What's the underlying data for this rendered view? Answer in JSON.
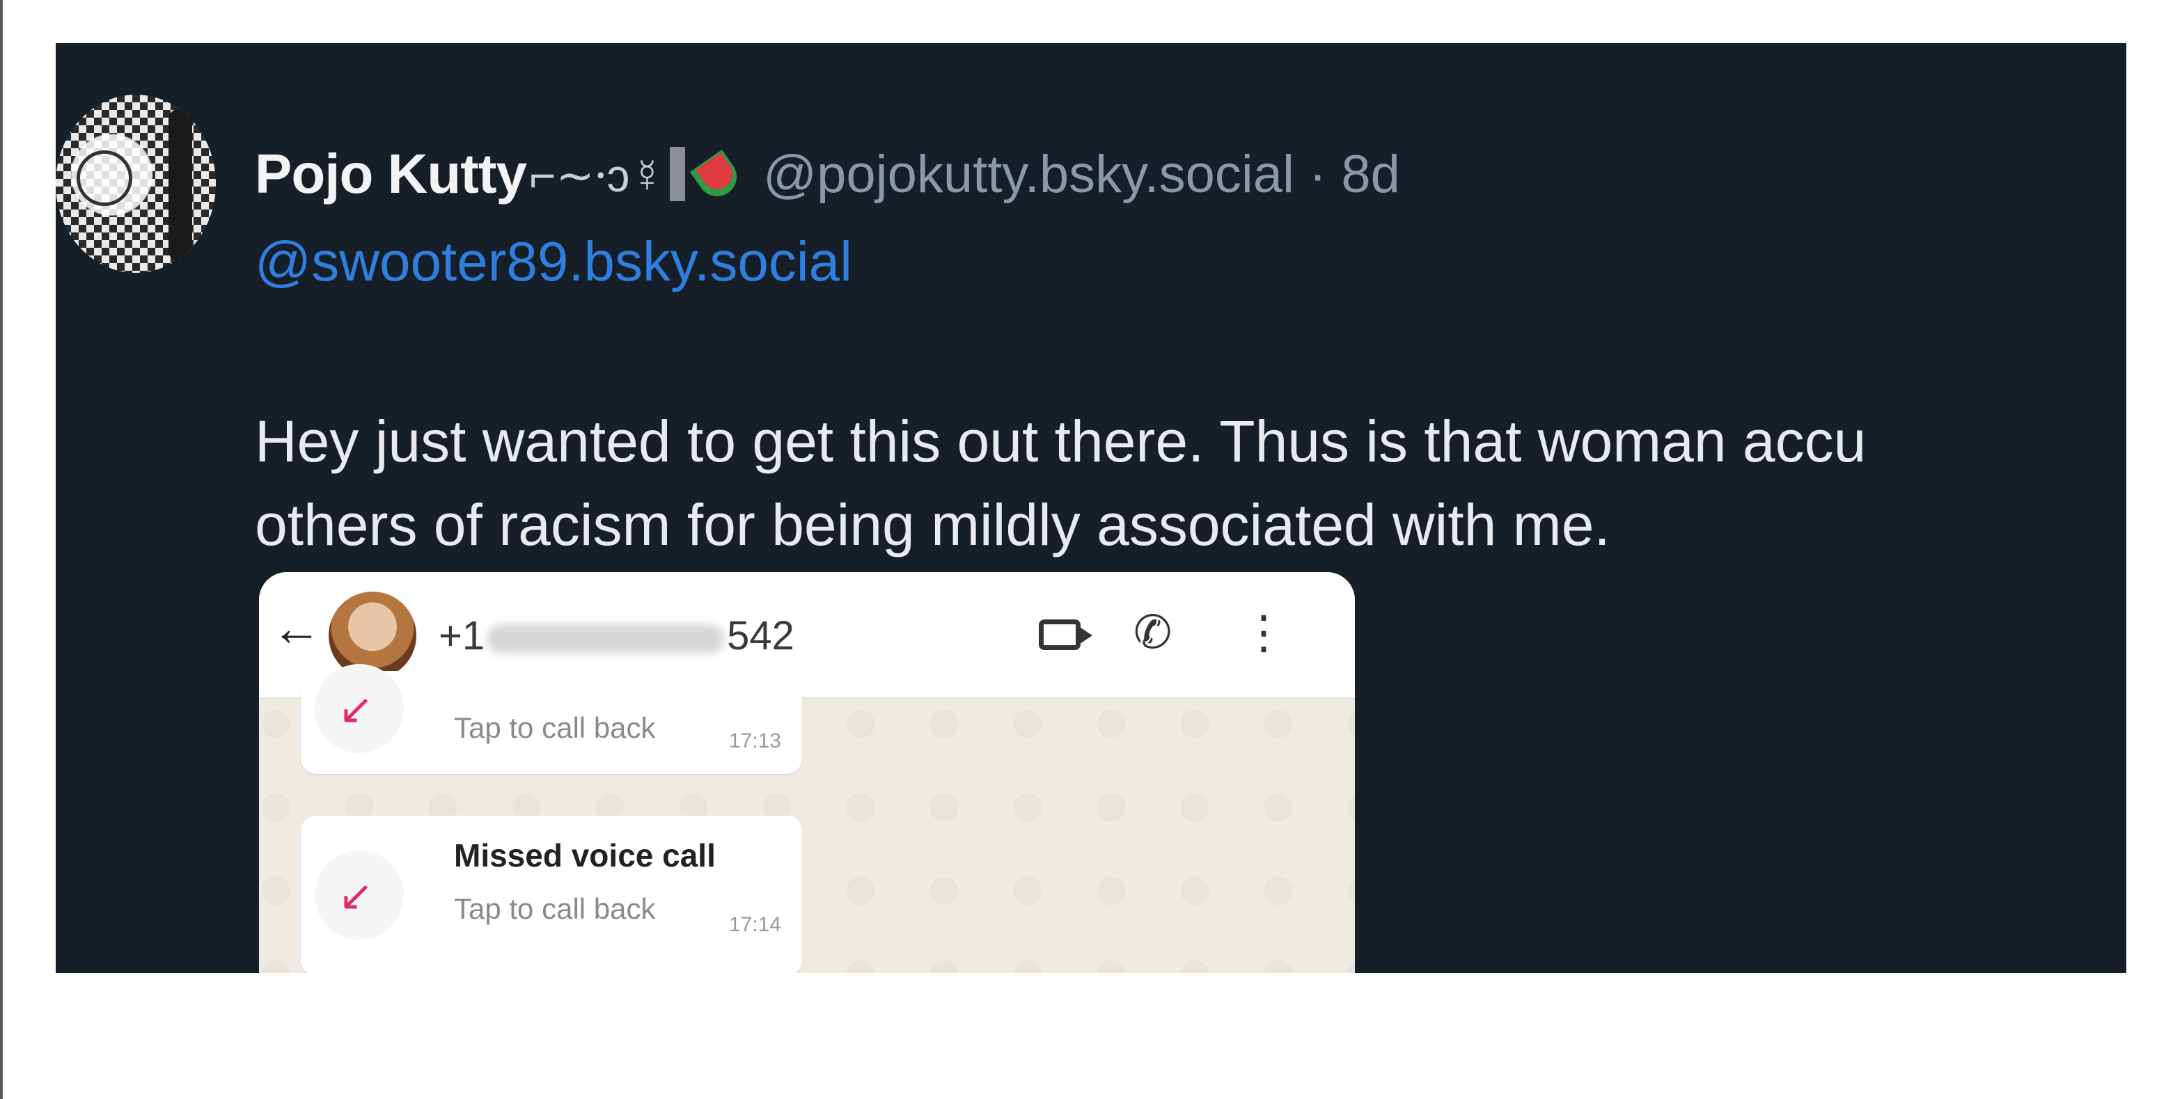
{
  "post": {
    "author_name": "Pojo Kutty",
    "name_decor": "⌐∼⸱ↄ☿",
    "handle_time": "@pojokutty.bsky.social · 8d",
    "reply_mention": "@swooter89.bsky.social",
    "text_lines": [
      "Hey just wanted to get this out there. Thus is that woman accu",
      "others of racism for being mildly associated with me."
    ]
  },
  "embed": {
    "back_glyph": "←",
    "phone_prefix": "+1",
    "phone_suffix": "542",
    "call_glyph": "✆",
    "menu_glyph": "⋮",
    "bubbles": [
      {
        "title": "",
        "subtitle": "Tap to call back",
        "time": "17:13"
      },
      {
        "title": "Missed voice call",
        "subtitle": "Tap to call back",
        "time": "17:14"
      }
    ]
  },
  "icons": {
    "avatar": "avatar-icon",
    "melon": "watermelon-icon",
    "missed_call": "missed-call-icon",
    "video": "video-call-icon",
    "phone": "phone-call-icon",
    "menu": "more-menu-icon"
  },
  "colors": {
    "card_bg": "#161e27",
    "mention": "#2f7fe0",
    "muted": "#8b98a5",
    "missed_call": "#e02a6a"
  }
}
